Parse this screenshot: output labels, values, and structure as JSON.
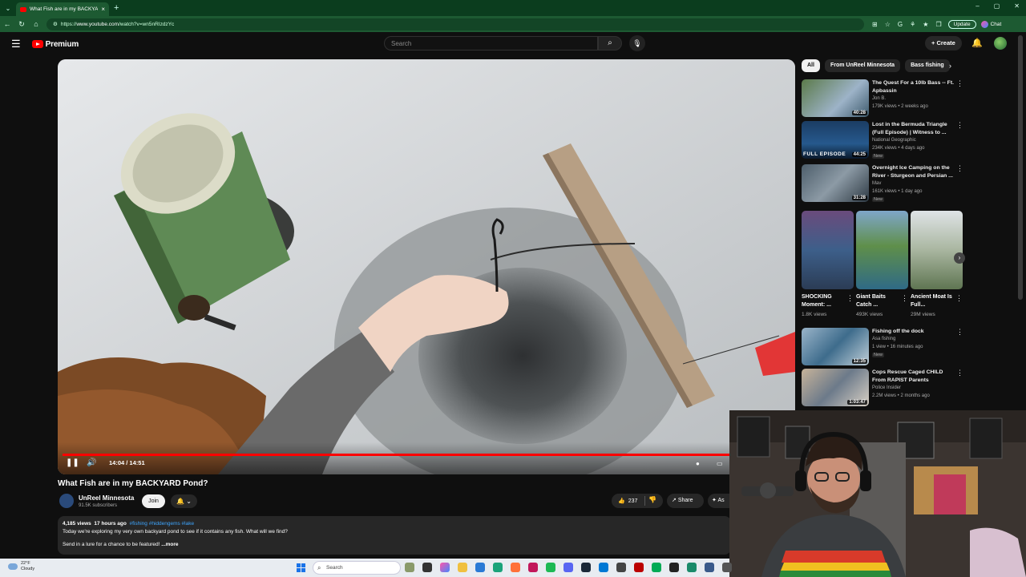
{
  "browser": {
    "tab_title": "What Fish are in my BACKYARD Pond?",
    "url_prefix": "https://",
    "url_host": "www.youtube.com",
    "url_path": "/watch?v=wn5nRIzdzYc",
    "update_label": "Update",
    "chat_label": "Chat"
  },
  "header": {
    "logo_text": "Premium",
    "search_placeholder": "Search",
    "create_label": "Create"
  },
  "player": {
    "time_current": "14:04",
    "time_total": "14:51",
    "time_display": "14:04 / 14:51",
    "progress_fraction": 0.947
  },
  "video": {
    "title": "What Fish are in my BACKYARD Pond?",
    "channel_name": "UnReel Minnesota",
    "subscribers": "91.5K subscribers",
    "join_label": "Join",
    "likes": "237",
    "share_label": "Share",
    "ask_label": "As",
    "views": "4,185 views",
    "age": "17 hours ago",
    "tags": "#fishing #hiddengems #lake",
    "description_line1": "Today we're exploring my very own backyard pond to see if it contains any fish. What will we find?",
    "description_line2": "Send in a lure for a chance to be featured!",
    "more_label": "...more"
  },
  "sidebar": {
    "chips": [
      "All",
      "From UnReel Minnesota",
      "Bass fishing"
    ],
    "recs_top": [
      {
        "title": "The Quest For a 10lb Bass -- Ft. Apbassin",
        "channel": "Jon B.",
        "views": "179K views • 2 weeks ago",
        "duration": "40:28",
        "badge": ""
      },
      {
        "title": "Lost in the Bermuda Triangle (Full Episode) | Witness to ...",
        "channel": "National Geographic",
        "views": "234K views • 4 days ago",
        "duration": "44:25",
        "badge": "New",
        "overlay": "FULL EPISODE"
      },
      {
        "title": "Overnight Ice Camping on the River - Sturgeon and Persian ...",
        "channel": "Mav",
        "views": "161K views • 1 day ago",
        "duration": "31:28",
        "badge": "New"
      }
    ],
    "shorts": [
      {
        "title": "SHOCKING Moment: ...",
        "views": "1.8K views"
      },
      {
        "title": "Giant Baits Catch ...",
        "views": "493K views"
      },
      {
        "title": "Ancient Moat Is Full...",
        "views": "29M views"
      }
    ],
    "recs_bottom": [
      {
        "title": "Fishing off the dock",
        "channel": "Asa fishing",
        "views": "1 view • 16 minutes ago",
        "duration": "12:35",
        "badge": "New"
      },
      {
        "title": "Cops Rescue Caged CHILD From RAPIST Parents",
        "channel": "Police Insider",
        "views": "2.2M views • 2 months ago",
        "duration": "1:03:47",
        "badge": ""
      }
    ]
  },
  "taskbar": {
    "temperature": "22°F",
    "condition": "Cloudy",
    "search_label": "Search"
  }
}
